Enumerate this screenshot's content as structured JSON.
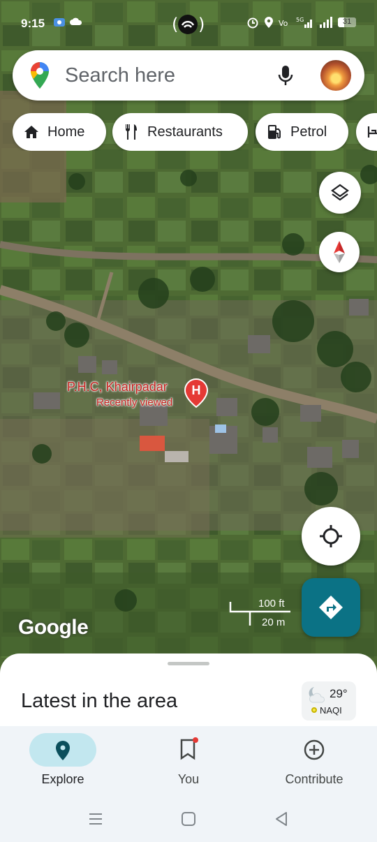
{
  "status_bar": {
    "time": "9:15",
    "battery": "31"
  },
  "search": {
    "placeholder": "Search here"
  },
  "chips": [
    {
      "label": "Home",
      "icon": "home-icon"
    },
    {
      "label": "Restaurants",
      "icon": "restaurant-icon"
    },
    {
      "label": "Petrol",
      "icon": "fuel-icon"
    },
    {
      "label": "",
      "icon": "hotel-icon"
    }
  ],
  "map": {
    "place_name": "P.H.C, Khairpadar",
    "place_sub": "Recently viewed",
    "marker_letter": "H",
    "logo_text": "Google",
    "scale_ft": "100 ft",
    "scale_m": "20 m"
  },
  "sheet": {
    "title": "Latest in the area",
    "weather_temp": "29°",
    "weather_aqi": "NAQI"
  },
  "nav": {
    "explore": "Explore",
    "you": "You",
    "contribute": "Contribute"
  },
  "colors": {
    "accent": "#0b7285",
    "explore_pill": "#c2e7ef",
    "marker": "#e53935"
  }
}
